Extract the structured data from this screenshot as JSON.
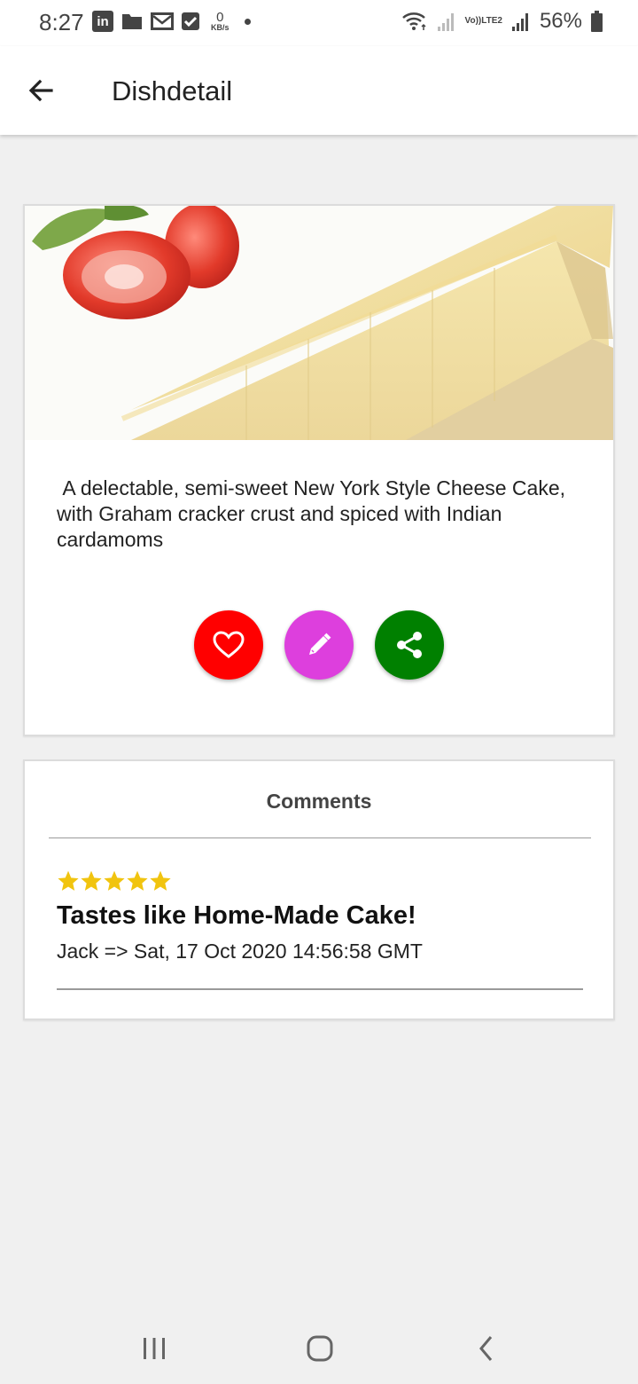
{
  "status_bar": {
    "time": "8:27",
    "linkedin_icon_label": "in",
    "data_speed_value": "0",
    "data_speed_unit": "KB/s",
    "network_label_top": "Vo))",
    "network_label_bottom": "LTE2",
    "battery_percent": "56%"
  },
  "app_bar": {
    "title": "Dishdetail"
  },
  "dish": {
    "description": " A delectable, semi-sweet New York Style Cheese Cake, with Graham cracker crust and spiced with Indian cardamoms",
    "image_icon": "cheesecake-image"
  },
  "actions": {
    "favorite_color": "#ff0000",
    "comment_color": "#dd3fdd",
    "share_color": "#008000"
  },
  "comments": {
    "header": "Comments",
    "items": [
      {
        "rating": 5,
        "title": "Tastes like Home-Made Cake!",
        "meta": "Jack => Sat, 17 Oct 2020 14:56:58 GMT"
      }
    ]
  },
  "colors": {
    "star": "#f1c40f",
    "background": "#f0f0f0"
  }
}
